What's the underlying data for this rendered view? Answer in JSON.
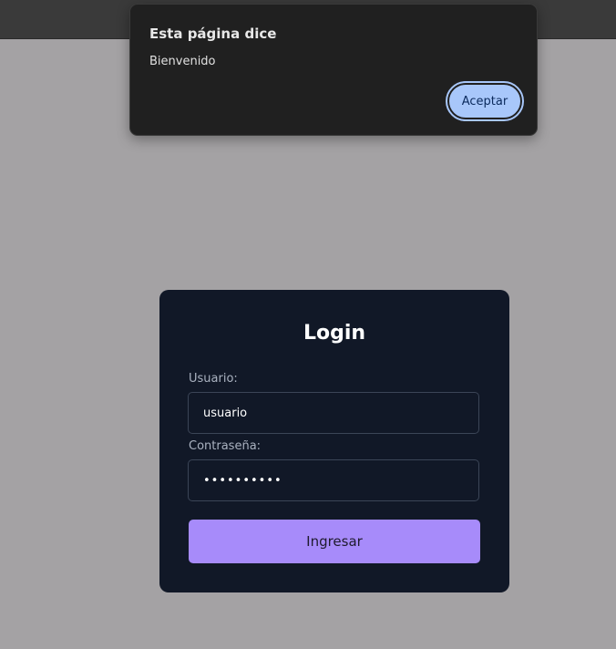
{
  "alert": {
    "title": "Esta página dice",
    "message": "Bienvenido",
    "accept_label": "Aceptar"
  },
  "login": {
    "title": "Login",
    "username_label": "Usuario:",
    "username_value": "usuario",
    "password_label": "Contraseña:",
    "password_value": "••••••••••",
    "submit_label": "Ingresar"
  },
  "colors": {
    "page_background": "#a4a2a4",
    "card_background": "#111827",
    "accent": "#a78bfa",
    "dialog_background": "#202020",
    "dialog_button": "#a8c7fa"
  }
}
